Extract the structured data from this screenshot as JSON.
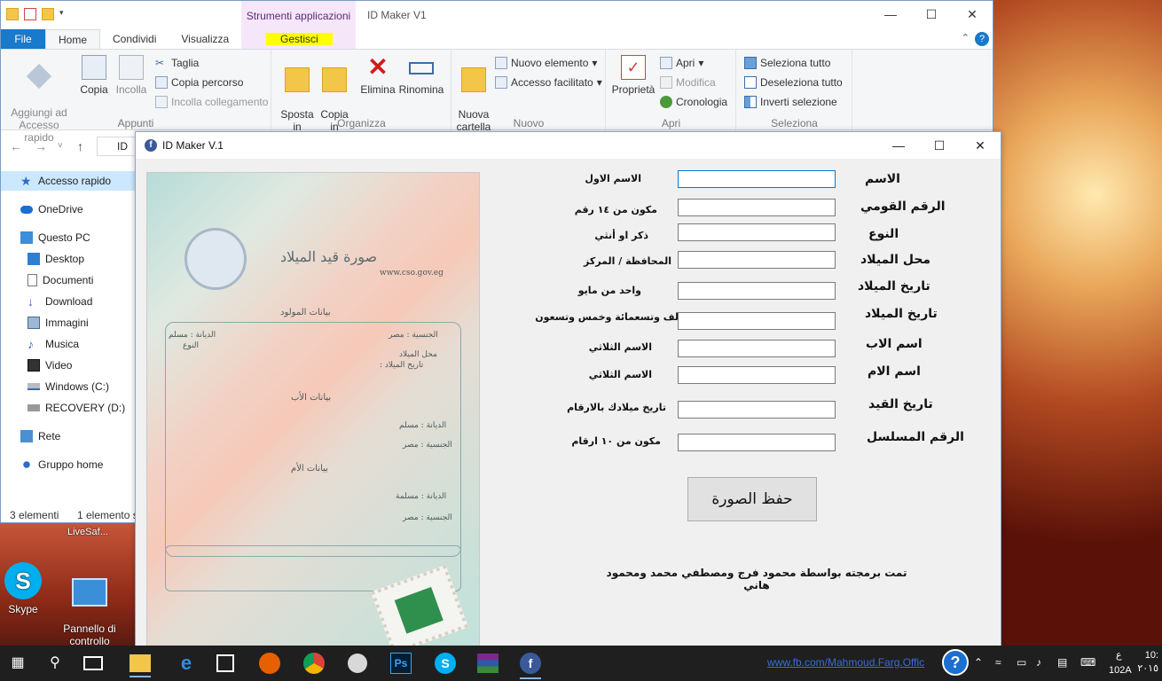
{
  "explorer": {
    "contextual_group": "Strumenti applicazioni",
    "window_title": "ID Maker V1",
    "tabs": [
      "File",
      "Home",
      "Condividi",
      "Visualizza"
    ],
    "contextual_tab": "Gestisci",
    "ribbon": {
      "appunti": {
        "name": "Appunti",
        "pin": "Aggiungi ad\nAccesso rapido",
        "copy": "Copia",
        "paste": "Incolla",
        "cut": "Taglia",
        "copy_path": "Copia percorso",
        "paste_link": "Incolla collegamento"
      },
      "organizza": {
        "name": "Organizza",
        "move_to": "Sposta\nin",
        "copy_to": "Copia\nin",
        "delete": "Elimina",
        "rename": "Rinomina"
      },
      "nuovo": {
        "name": "Nuovo",
        "new_folder": "Nuova\ncartella",
        "new_item": "Nuovo elemento",
        "easy_access": "Accesso facilitato"
      },
      "apri": {
        "name": "Apri",
        "properties": "Proprietà",
        "open": "Apri",
        "edit": "Modifica",
        "history": "Cronologia"
      },
      "seleziona": {
        "name": "Seleziona",
        "select_all": "Seleziona tutto",
        "select_none": "Deseleziona tutto",
        "invert": "Inverti selezione"
      }
    },
    "address_fragment": "ID",
    "nav_items": [
      {
        "label": "Accesso rapido",
        "icon": "star-icon",
        "selected": true
      },
      {
        "label": "OneDrive",
        "icon": "cloud-icon"
      },
      {
        "label": "Questo PC",
        "icon": "computer-icon"
      },
      {
        "label": "Desktop",
        "icon": "desktop-icon"
      },
      {
        "label": "Documenti",
        "icon": "document-icon"
      },
      {
        "label": "Download",
        "icon": "download-icon"
      },
      {
        "label": "Immagini",
        "icon": "image-icon"
      },
      {
        "label": "Musica",
        "icon": "music-icon"
      },
      {
        "label": "Video",
        "icon": "video-icon"
      },
      {
        "label": "Windows (C:)",
        "icon": "drive-icon"
      },
      {
        "label": "RECOVERY (D:)",
        "icon": "drive-icon"
      },
      {
        "label": "Rete",
        "icon": "network-icon"
      },
      {
        "label": "Gruppo home",
        "icon": "homegroup-icon"
      }
    ],
    "status_count": "3 elementi",
    "status_selected": "1 elemento s"
  },
  "idmaker": {
    "title": "ID Maker V.1",
    "fields": [
      {
        "label": "الاسم",
        "hint": "الاسم الاول",
        "value": ""
      },
      {
        "label": "الرقم القومي",
        "hint": "مكون من ١٤ رقم",
        "value": ""
      },
      {
        "label": "النوع",
        "hint": "ذكر او أنثي",
        "value": ""
      },
      {
        "label": "محل الميلاد",
        "hint": "المحافظة / المركز",
        "value": ""
      },
      {
        "label": "تاريخ الميلاد",
        "hint": "واحد من مايو",
        "value": ""
      },
      {
        "label": "تاريخ الميلاد",
        "hint": "لف وتسعمائة وخمس وتسعون",
        "value": ""
      },
      {
        "label": "اسم الاب",
        "hint": "الاسم الثلاثي",
        "value": ""
      },
      {
        "label": "اسم الام",
        "hint": "الاسم الثلاثي",
        "value": ""
      },
      {
        "label": "تاريخ القيد",
        "hint": "تاريخ ميلادك بالارقام",
        "value": ""
      },
      {
        "label": "الرقم المسلسل",
        "hint": "مكون من ١٠ ارقام",
        "value": ""
      }
    ],
    "save_button": "حفظ الصورة",
    "credit": "تمت برمجته بواسطة محمود فرج ومصطفي محمد ومحمود هاني",
    "card": {
      "title": "صورة قيد الميلاد",
      "website": "www.cso.gov.eg",
      "section_child": "بيانات المولود",
      "section_father": "بيانات الأب",
      "section_mother": "بيانات الأم",
      "religion_child": "الديانة : مسلم",
      "gender": "النوع",
      "nationality_child": "الجنسية : مصر",
      "birthplace": "محل الميلاد",
      "birthdate": "تاريخ الميلاد :",
      "religion_father": "الديانة : مسلم",
      "nationality_father": "الجنسية : مصر",
      "religion_mother": "الديانة : مسلمة",
      "nationality_mother": "الجنسية : مصر"
    }
  },
  "desktop": {
    "icons": [
      {
        "label": "Skype"
      },
      {
        "label": "Pannello di\ncontrollo"
      }
    ],
    "livesafe": "LiveSaf..."
  },
  "taskbar": {
    "link": "www.fb.com/Mahmoud.Farg.Offic",
    "clock_time": "10:",
    "clock_date": "٢٠١٥",
    "ime": "ع",
    "keyboard": "102A"
  }
}
